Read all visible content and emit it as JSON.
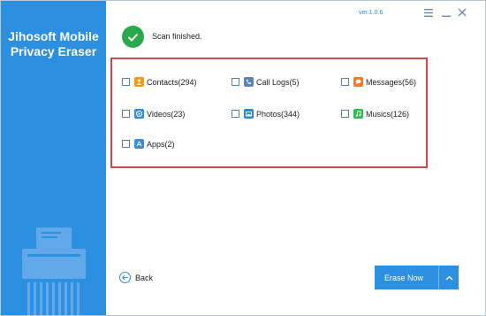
{
  "app": {
    "title_line1": "Jihosoft Mobile",
    "title_line2": "Privacy Eraser",
    "version": "ver:1.0.6"
  },
  "status": {
    "text": "Scan finished."
  },
  "categories": [
    {
      "label": "Contacts(294)",
      "icon": "contacts-icon",
      "color": "#f29a1f"
    },
    {
      "label": "Call Logs(5)",
      "icon": "call-logs-icon",
      "color": "#5f86b1"
    },
    {
      "label": "Messages(56)",
      "icon": "messages-icon",
      "color": "#ef7a2e"
    },
    {
      "label": "Videos(23)",
      "icon": "videos-icon",
      "color": "#2d8fe0"
    },
    {
      "label": "Photos(344)",
      "icon": "photos-icon",
      "color": "#2a8ad0"
    },
    {
      "label": "Musics(126)",
      "icon": "musics-icon",
      "color": "#2ebd4c"
    },
    {
      "label": "Apps(2)",
      "icon": "apps-icon",
      "color": "#3a8fd8"
    }
  ],
  "buttons": {
    "back": "Back",
    "erase": "Erase Now"
  },
  "colors": {
    "sidebar": "#2d8fe0",
    "accent": "#2d8fe0",
    "success": "#28a94a",
    "panel_border": "#d9454c"
  }
}
